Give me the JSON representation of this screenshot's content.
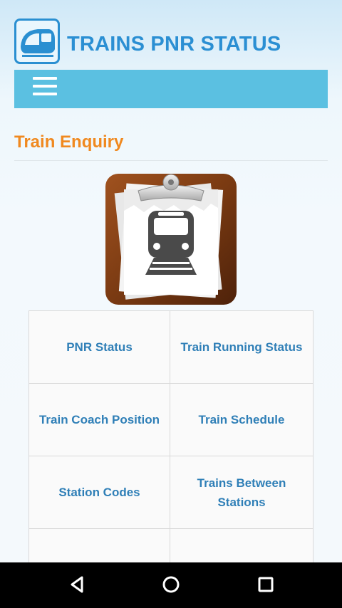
{
  "header": {
    "logo_icon": "train-icon",
    "title": "TRAINS PNR STATUS"
  },
  "navbar": {
    "menu_icon": "hamburger-menu-icon"
  },
  "section": {
    "title": "Train Enquiry"
  },
  "hero": {
    "icon": "train-clipboard-icon"
  },
  "menu_items": [
    {
      "label": "PNR Status"
    },
    {
      "label": "Train Running Status"
    },
    {
      "label": "Train Coach Position"
    },
    {
      "label": "Train Schedule"
    },
    {
      "label": "Station Codes"
    },
    {
      "label": "Trains Between Stations"
    }
  ],
  "system_nav": {
    "back_icon": "back-icon",
    "home_icon": "home-icon",
    "recents_icon": "recents-icon"
  },
  "colors": {
    "brand_blue": "#2b8fd3",
    "navbar": "#5bc0e1",
    "section_orange": "#f0891f",
    "cell_text": "#2f7fb7"
  }
}
